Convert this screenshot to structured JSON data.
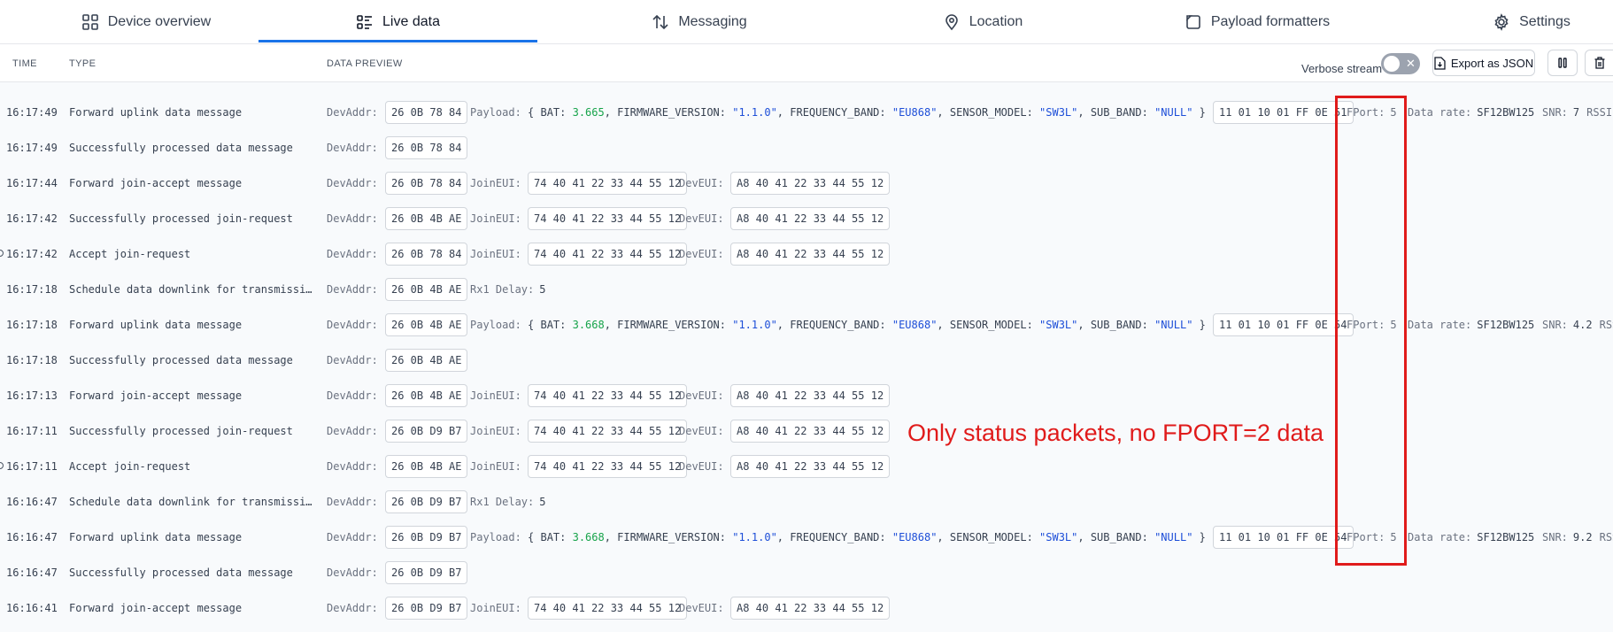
{
  "nav": {
    "tabs": [
      {
        "label": "Device overview",
        "icon": "grid-icon"
      },
      {
        "label": "Live data",
        "icon": "list-icon",
        "active": true
      },
      {
        "label": "Messaging",
        "icon": "up-down-arrows-icon"
      },
      {
        "label": "Location",
        "icon": "location-pin-icon"
      },
      {
        "label": "Payload formatters",
        "icon": "code-icon"
      },
      {
        "label": "Settings",
        "icon": "gear-icon"
      }
    ]
  },
  "table": {
    "headers": {
      "time": "TIME",
      "type": "TYPE",
      "preview": "DATA PREVIEW"
    }
  },
  "toolbar": {
    "verbose_label": "Verbose stream",
    "verbose_on": false,
    "export_label": "Export as JSON"
  },
  "labels": {
    "devaddr": "DevAddr:",
    "joineui": "JoinEUI:",
    "deveui": "DevEUI:",
    "payload": "Payload:",
    "rx1": "Rx1 Delay:",
    "fport": "FPort:",
    "datarate": "Data rate:",
    "snr": "SNR:",
    "rssi": "RSSI"
  },
  "rows": [
    {
      "time": "16:17:49",
      "type": "Forward uplink data message",
      "kind": "uplink",
      "devaddr": "26 0B 78 84",
      "bat": "3.665",
      "firmware": "\"1.1.0\"",
      "band": "\"EU868\"",
      "model": "\"SW3L\"",
      "subband": "\"NULL\"",
      "raw": "11 01 10 01 FF 0E 51",
      "fport": "5",
      "datarate": "SF12BW125",
      "snr": "7"
    },
    {
      "time": "16:17:49",
      "type": "Successfully processed data message",
      "kind": "addr",
      "devaddr": "26 0B 78 84"
    },
    {
      "time": "16:17:44",
      "type": "Forward join-accept message",
      "kind": "join",
      "devaddr": "26 0B 78 84",
      "joineui": "74 40 41 22 33 44 55 12",
      "deveui": "A8 40 41 22 33 44 55 12"
    },
    {
      "time": "16:17:42",
      "type": "Successfully processed join-request",
      "kind": "join",
      "devaddr": "26 0B 4B AE",
      "joineui": "74 40 41 22 33 44 55 12",
      "deveui": "A8 40 41 22 33 44 55 12"
    },
    {
      "time": "16:17:42",
      "type": "Accept join-request",
      "kind": "join",
      "dot": true,
      "devaddr": "26 0B 78 84",
      "joineui": "74 40 41 22 33 44 55 12",
      "deveui": "A8 40 41 22 33 44 55 12"
    },
    {
      "time": "16:17:18",
      "type": "Schedule data downlink for transmissi…",
      "kind": "rx",
      "devaddr": "26 0B 4B AE",
      "rx1": "5"
    },
    {
      "time": "16:17:18",
      "type": "Forward uplink data message",
      "kind": "uplink",
      "devaddr": "26 0B 4B AE",
      "bat": "3.668",
      "firmware": "\"1.1.0\"",
      "band": "\"EU868\"",
      "model": "\"SW3L\"",
      "subband": "\"NULL\"",
      "raw": "11 01 10 01 FF 0E 54",
      "fport": "5",
      "datarate": "SF12BW125",
      "snr": "4.2"
    },
    {
      "time": "16:17:18",
      "type": "Successfully processed data message",
      "kind": "addr",
      "devaddr": "26 0B 4B AE"
    },
    {
      "time": "16:17:13",
      "type": "Forward join-accept message",
      "kind": "join",
      "devaddr": "26 0B 4B AE",
      "joineui": "74 40 41 22 33 44 55 12",
      "deveui": "A8 40 41 22 33 44 55 12"
    },
    {
      "time": "16:17:11",
      "type": "Successfully processed join-request",
      "kind": "join",
      "devaddr": "26 0B D9 B7",
      "joineui": "74 40 41 22 33 44 55 12",
      "deveui": "A8 40 41 22 33 44 55 12"
    },
    {
      "time": "16:17:11",
      "type": "Accept join-request",
      "kind": "join",
      "dot": true,
      "devaddr": "26 0B 4B AE",
      "joineui": "74 40 41 22 33 44 55 12",
      "deveui": "A8 40 41 22 33 44 55 12"
    },
    {
      "time": "16:16:47",
      "type": "Schedule data downlink for transmissi…",
      "kind": "rx",
      "devaddr": "26 0B D9 B7",
      "rx1": "5"
    },
    {
      "time": "16:16:47",
      "type": "Forward uplink data message",
      "kind": "uplink",
      "devaddr": "26 0B D9 B7",
      "bat": "3.668",
      "firmware": "\"1.1.0\"",
      "band": "\"EU868\"",
      "model": "\"SW3L\"",
      "subband": "\"NULL\"",
      "raw": "11 01 10 01 FF 0E 54",
      "fport": "5",
      "datarate": "SF12BW125",
      "snr": "9.2"
    },
    {
      "time": "16:16:47",
      "type": "Successfully processed data message",
      "kind": "addr",
      "devaddr": "26 0B D9 B7"
    },
    {
      "time": "16:16:41",
      "type": "Forward join-accept message",
      "kind": "join",
      "devaddr": "26 0B D9 B7",
      "joineui": "74 40 41 22 33 44 55 12",
      "deveui": "A8 40 41 22 33 44 55 12"
    }
  ],
  "annotation": {
    "text": "Only status packets, no FPORT=2 data",
    "color": "#e01b1b"
  },
  "colors": {
    "accent": "#1a73e8",
    "number": "#16a34a",
    "string": "#1d4ed8"
  }
}
